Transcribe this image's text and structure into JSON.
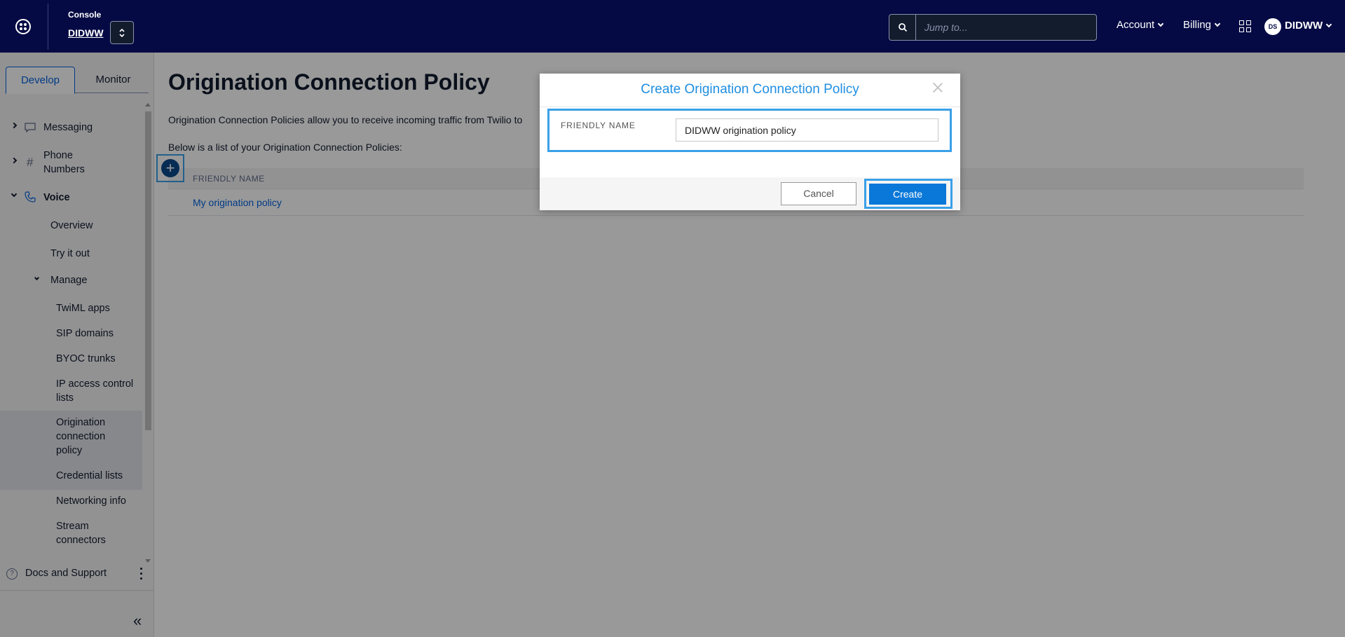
{
  "topbar": {
    "console_label": "Console",
    "account_name": "DIDWW",
    "search_placeholder": "Jump to...",
    "account_menu": "Account",
    "billing_menu": "Billing",
    "avatar_initials": "DS",
    "user_name": "DIDWW"
  },
  "sidebar": {
    "tabs": [
      "Develop",
      "Monitor"
    ],
    "items": {
      "messaging": "Messaging",
      "phone_numbers_line1": "Phone",
      "phone_numbers_line2": "Numbers",
      "voice": "Voice",
      "overview": "Overview",
      "try_it_out": "Try it out",
      "manage": "Manage",
      "twiml_apps": "TwiML apps",
      "sip_domains": "SIP domains",
      "byoc_trunks": "BYOC trunks",
      "ip_acl_line1": "IP access control",
      "ip_acl_line2": "lists",
      "origination_line1": "Origination",
      "origination_line2": "connection",
      "origination_line3": "policy",
      "credential_lists": "Credential lists",
      "networking_info": "Networking info",
      "stream_line1": "Stream",
      "stream_line2": "connectors"
    },
    "docs_support": "Docs and Support",
    "collapse_glyph": "«"
  },
  "main": {
    "title": "Origination Connection Policy",
    "description": "Origination Connection Policies allow you to receive incoming traffic from Twilio to",
    "list_intro": "Below is a list of your Origination Connection Policies:",
    "add_glyph": "+",
    "table_header": "FRIENDLY NAME",
    "rows": [
      "My origination policy"
    ]
  },
  "modal": {
    "title": "Create Origination Connection Policy",
    "field_label": "FRIENDLY NAME",
    "field_value": "DIDWW origination policy",
    "cancel_label": "Cancel",
    "create_label": "Create"
  },
  "colors": {
    "topbar_bg": "#050a44",
    "accent_blue": "#0263e0",
    "highlight": "#3aa0e8",
    "create_button": "#0a78d8"
  }
}
